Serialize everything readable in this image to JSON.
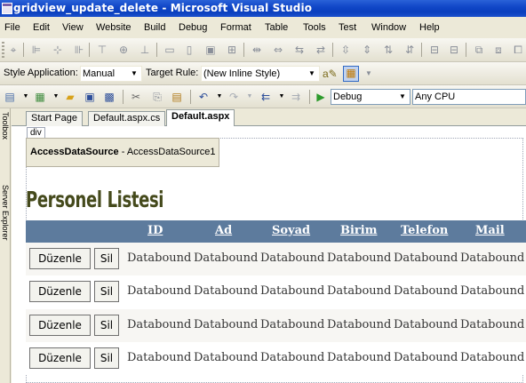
{
  "window": {
    "title": "gridview_update_delete - Microsoft Visual Studio"
  },
  "menu": [
    "File",
    "Edit",
    "View",
    "Website",
    "Build",
    "Debug",
    "Format",
    "Table",
    "Tools",
    "Test",
    "Window",
    "Help"
  ],
  "style_toolbar": {
    "style_application_label": "Style Application:",
    "style_application_value": "Manual",
    "target_rule_label": "Target Rule:",
    "target_rule_value": "(New Inline Style)"
  },
  "standard_toolbar": {
    "configuration": "Debug",
    "platform": "Any CPU"
  },
  "side_panels": [
    "Toolbox",
    "Server Explorer"
  ],
  "tabs": [
    {
      "label": "Start Page",
      "active": false
    },
    {
      "label": "Default.aspx.cs",
      "active": false
    },
    {
      "label": "Default.aspx",
      "active": true
    }
  ],
  "designer": {
    "div_tag": "div",
    "datasource_type": "AccessDataSource",
    "datasource_name": "AccessDataSource1",
    "heading": "Personel Listesi",
    "columns": [
      "ID",
      "Ad",
      "Soyad",
      "Birim",
      "Telefon",
      "Mail"
    ],
    "edit_label": "Düzenle",
    "delete_label": "Sil",
    "rows": [
      [
        "Databound",
        "Databound",
        "Databound",
        "Databound",
        "Databound",
        "Databound"
      ],
      [
        "Databound",
        "Databound",
        "Databound",
        "Databound",
        "Databound",
        "Databound"
      ],
      [
        "Databound",
        "Databound",
        "Databound",
        "Databound",
        "Databound",
        "Databound"
      ],
      [
        "Databound",
        "Databound",
        "Databound",
        "Databound",
        "Databound",
        "Databound"
      ]
    ]
  },
  "colors": {
    "titlebar": "#0a3fbe",
    "grid_header": "#5d7b9d",
    "heading": "#454a1c"
  }
}
